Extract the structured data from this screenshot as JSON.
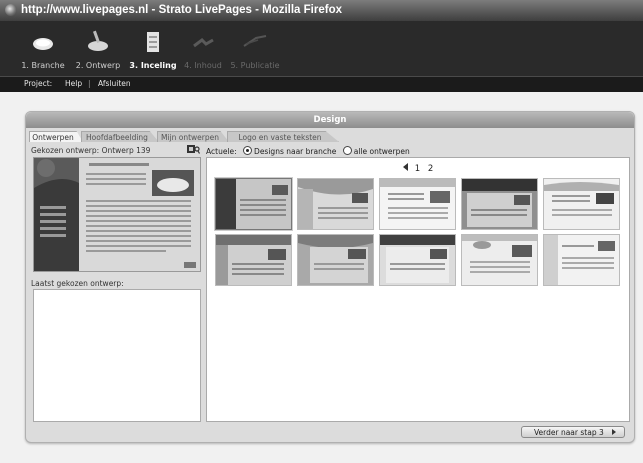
{
  "window": {
    "title": "http://www.livepages.nl - Strato LivePages - Mozilla Firefox"
  },
  "steps": [
    {
      "label": "1. Branche",
      "icon": "plate-icon",
      "state": "done"
    },
    {
      "label": "2. Ontwerp",
      "icon": "paint-pot-icon",
      "state": "done"
    },
    {
      "label": "3. Inceling",
      "icon": "layout-stack-icon",
      "state": "active"
    },
    {
      "label": "4. Inhoud",
      "icon": "content-icon",
      "state": "disabled"
    },
    {
      "label": "5. Publicatie",
      "icon": "publish-icon",
      "state": "disabled"
    }
  ],
  "menu": {
    "project": "Project:",
    "help": "Help",
    "separator": "|",
    "close": "Afsluiten"
  },
  "panel": {
    "title": "Design"
  },
  "tabs": [
    "Ontwerpen",
    "Hoofdafbeelding",
    "Mijn ontwerpen",
    "Logo en vaste teksten"
  ],
  "left": {
    "chosen_label": "Gekozen ontwerp: Ontwerp 139",
    "last_label": "Laatst gekozen ontwerp:"
  },
  "filter": {
    "label": "Actuele:",
    "option_branche": "Designs naar branche",
    "option_all": "alle ontwerpen",
    "selected": "Designs naar branche"
  },
  "pager": {
    "pages": [
      "1",
      "2"
    ]
  },
  "thumbnails": [
    {
      "name": "design-thumb-1",
      "style": "dark",
      "selected": true
    },
    {
      "name": "design-thumb-2",
      "style": "pink-swoosh",
      "selected": false
    },
    {
      "name": "design-thumb-3",
      "style": "light-blocks",
      "selected": false
    },
    {
      "name": "design-thumb-4",
      "style": "dark-header",
      "selected": false
    },
    {
      "name": "design-thumb-5",
      "style": "light-wave",
      "selected": false
    },
    {
      "name": "design-thumb-6",
      "style": "blue-top",
      "selected": false
    },
    {
      "name": "design-thumb-7",
      "style": "grey-curve",
      "selected": false
    },
    {
      "name": "design-thumb-8",
      "style": "dark-bar",
      "selected": false
    },
    {
      "name": "design-thumb-9",
      "style": "car-top",
      "selected": false
    },
    {
      "name": "design-thumb-10",
      "style": "plain-left",
      "selected": false
    }
  ],
  "buttons": {
    "next": "Verder naar stap 3"
  }
}
